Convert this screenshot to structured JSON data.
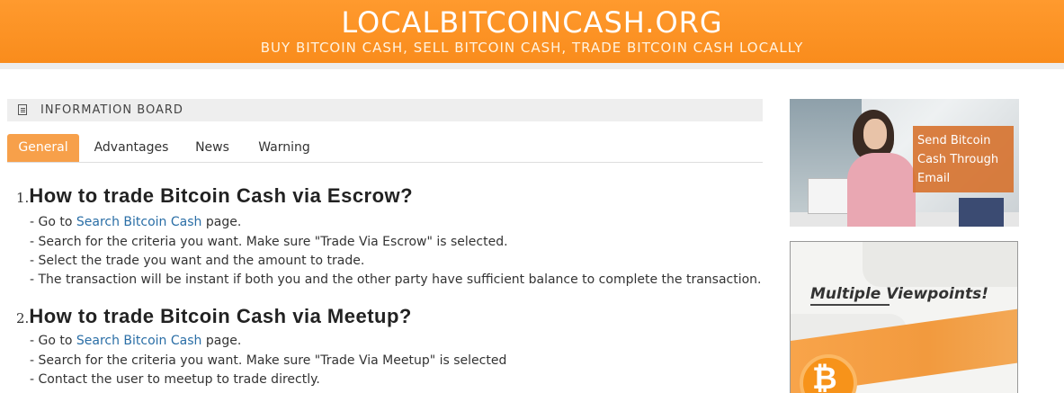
{
  "header": {
    "title": "LOCALBITCOINCASH.ORG",
    "subtitle": "BUY BITCOIN CASH, SELL BITCOIN CASH, TRADE BITCOIN CASH LOCALLY"
  },
  "board": {
    "title": "INFORMATION BOARD",
    "icon": "document-icon",
    "tabs": [
      "General",
      "Advantages",
      "News",
      "Warning"
    ],
    "active_tab": "General"
  },
  "faq": [
    {
      "num": "1.",
      "title": "How to trade Bitcoin Cash via Escrow?",
      "lines": [
        {
          "pre": "- Go to ",
          "link": "Search Bitcoin Cash",
          "post": " page."
        },
        {
          "text": "- Search for the criteria you want. Make sure \"Trade Via Escrow\" is selected."
        },
        {
          "text": "- Select the trade you want and the amount to trade."
        },
        {
          "text": "- The transaction will be instant if both you and the other party have sufficient balance to complete the transaction."
        }
      ]
    },
    {
      "num": "2.",
      "title": "How to trade Bitcoin Cash via Meetup?",
      "lines": [
        {
          "pre": "- Go to ",
          "link": "Search Bitcoin Cash",
          "post": " page."
        },
        {
          "text": "- Search for the criteria you want. Make sure \"Trade Via Meetup\" is selected"
        },
        {
          "text": "- Contact the user to meetup to trade directly."
        }
      ]
    }
  ],
  "ads": {
    "email_ad_text": "Send Bitcoin Cash Through Email",
    "viewpoints_ad_text": "Multiple Viewpoints!",
    "coin_symbol": "₿"
  },
  "colors": {
    "brand_orange": "#f98c1c",
    "link_blue": "#2a6ea6",
    "tab_active": "#f7a04a"
  }
}
